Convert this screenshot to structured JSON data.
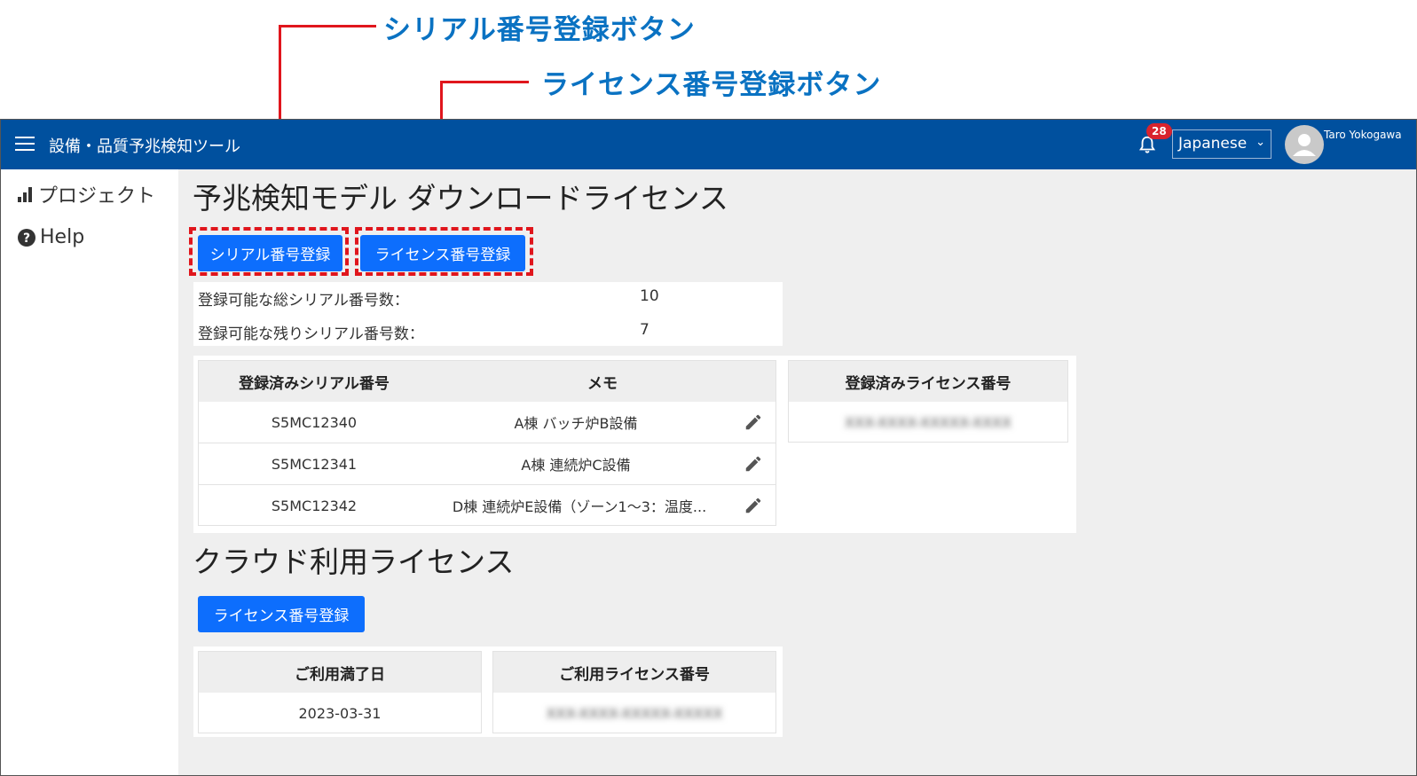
{
  "annotations": {
    "serial_button_label": "シリアル番号登録ボタン",
    "license_button_label": "ライセンス番号登録ボタン"
  },
  "header": {
    "title": "設備・品質予兆検知ツール",
    "notification_count": "28",
    "language": "Japanese",
    "user_name": "Taro Yokogawa"
  },
  "sidebar": {
    "items": [
      {
        "label": "プロジェクト",
        "icon": "bar-chart-icon"
      },
      {
        "label": "Help",
        "icon": "question-circle-icon"
      }
    ]
  },
  "download_license": {
    "title": "予兆検知モデル ダウンロードライセンス",
    "serial_register_button": "シリアル番号登録",
    "license_register_button": "ライセンス番号登録",
    "total_serial_label": "登録可能な総シリアル番号数：",
    "total_serial_value": "10",
    "remaining_serial_label": "登録可能な残りシリアル番号数：",
    "remaining_serial_value": "7",
    "serial_table": {
      "headers": [
        "登録済みシリアル番号",
        "メモ"
      ],
      "rows": [
        {
          "serial": "S5MC12340",
          "memo": "A棟 バッチ炉B設備"
        },
        {
          "serial": "S5MC12341",
          "memo": "A棟 連続炉C設備"
        },
        {
          "serial": "S5MC12342",
          "memo": "D棟 連続炉E設備（ゾーン1〜3：温度..."
        }
      ]
    },
    "license_table": {
      "header": "登録済みライセンス番号",
      "rows": [
        "XXX-XXXX-XXXXX-XXXX"
      ]
    }
  },
  "cloud_license": {
    "title": "クラウド利用ライセンス",
    "license_register_button": "ライセンス番号登録",
    "expiry_header": "ご利用満了日",
    "expiry_value": "2023-03-31",
    "license_header": "ご利用ライセンス番号",
    "license_value": "XXX-XXXX-XXXXX-XXXXX"
  },
  "colors": {
    "topbar": "#00509e",
    "button": "#0d6efd",
    "annotation_text": "#0a72c2",
    "annotation_line": "#e0161d"
  }
}
